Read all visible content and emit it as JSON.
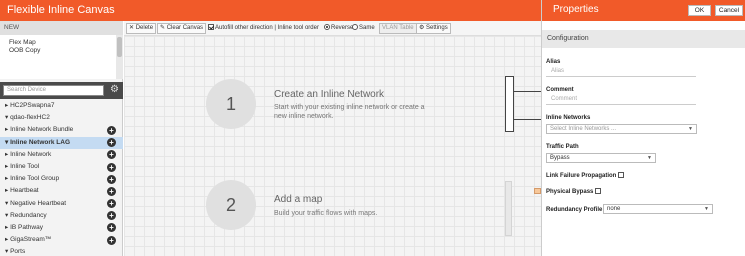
{
  "app": {
    "title": "Flexible Inline Canvas"
  },
  "left": {
    "new_label": "NEW",
    "maps": [
      "Flex Map",
      "OOB Copy"
    ],
    "search_placeholder": "Search Device",
    "tree": [
      {
        "label": "▸ HC2PSwapna7",
        "add": false,
        "selected": false
      },
      {
        "label": "▾ qdao-flexHC2",
        "add": false,
        "selected": false
      },
      {
        "label": "▸ Inline Network Bundle",
        "add": true,
        "selected": false
      },
      {
        "label": "▾ Inline Network LAG",
        "add": true,
        "selected": true
      },
      {
        "label": "▸ Inline Network",
        "add": true,
        "selected": false
      },
      {
        "label": "▸ Inline Tool",
        "add": true,
        "selected": false
      },
      {
        "label": "▸ Inline Tool Group",
        "add": true,
        "selected": false
      },
      {
        "label": "▸ Heartbeat",
        "add": true,
        "selected": false
      },
      {
        "label": "▾ Negative Heartbeat",
        "add": true,
        "selected": false
      },
      {
        "label": "▾ Redundancy",
        "add": true,
        "selected": false
      },
      {
        "label": "▸ IB Pathway",
        "add": true,
        "selected": false
      },
      {
        "label": "▸ GigaStream™",
        "add": true,
        "selected": false
      },
      {
        "label": "▾ Ports",
        "add": false,
        "selected": false
      }
    ]
  },
  "toolbar": {
    "delete_label": "✕ Delete",
    "clear_label": "✎ Clear Canvas",
    "autofill_label": "Autofill other direction | Inline tool order",
    "reverse_label": "Reverse",
    "same_label": "Same",
    "vlan_label": "VLAN Table",
    "settings_label": "⚙ Settings"
  },
  "canvas": {
    "step1": {
      "number": "1",
      "title": "Create an Inline Network",
      "desc": "Start with your existing inline network or create a new inline network."
    },
    "step2": {
      "number": "2",
      "title": "Add a map",
      "desc": "Build your traffic flows with maps."
    }
  },
  "properties": {
    "title": "Properties",
    "ok_label": "OK",
    "cancel_label": "Cancel",
    "config_label": "Configuration",
    "alias_label": "Alias",
    "alias_placeholder": "Alias",
    "comment_label": "Comment",
    "comment_placeholder": "Comment",
    "inline_networks_label": "Inline Networks",
    "inline_networks_placeholder": "Select Inline Networks ...",
    "traffic_path_label": "Traffic Path",
    "traffic_path_value": "Bypass",
    "link_failure_label": "Link Failure Propagation",
    "physical_bypass_label": "Physical Bypass",
    "redundancy_label": "Redundancy Profile",
    "redundancy_value": "none"
  },
  "colors": {
    "brand": "#f15a29",
    "selected_row": "#c4dbf2"
  }
}
